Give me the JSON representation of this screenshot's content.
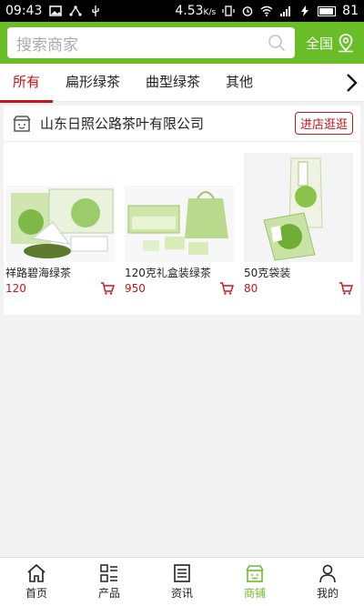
{
  "status": {
    "time": "09:43",
    "speed": "4.53",
    "speed_unit": "K/s",
    "battery": "81"
  },
  "search": {
    "placeholder": "搜索商家",
    "region": "全国"
  },
  "tabs": [
    {
      "label": "所有",
      "active": true
    },
    {
      "label": "扁形绿茶",
      "active": false
    },
    {
      "label": "曲型绿茶",
      "active": false
    },
    {
      "label": "其他",
      "active": false
    }
  ],
  "shop": {
    "name": "山东日照公路茶叶有限公司",
    "visit_label": "进店逛逛",
    "products": [
      {
        "name": "祥路碧海绿茶",
        "price": "120"
      },
      {
        "name": "120克礼盒装绿茶",
        "price": "950"
      },
      {
        "name": "50克袋装",
        "price": "80"
      }
    ]
  },
  "bottom_nav": [
    {
      "label": "首页",
      "icon": "home-icon",
      "active": false
    },
    {
      "label": "产品",
      "icon": "grid-list-icon",
      "active": false
    },
    {
      "label": "资讯",
      "icon": "document-icon",
      "active": false
    },
    {
      "label": "商铺",
      "icon": "store-icon",
      "active": true
    },
    {
      "label": "我的",
      "icon": "user-icon",
      "active": false
    }
  ],
  "colors": {
    "brand_green": "#69be28",
    "accent_red": "#c8141b"
  }
}
